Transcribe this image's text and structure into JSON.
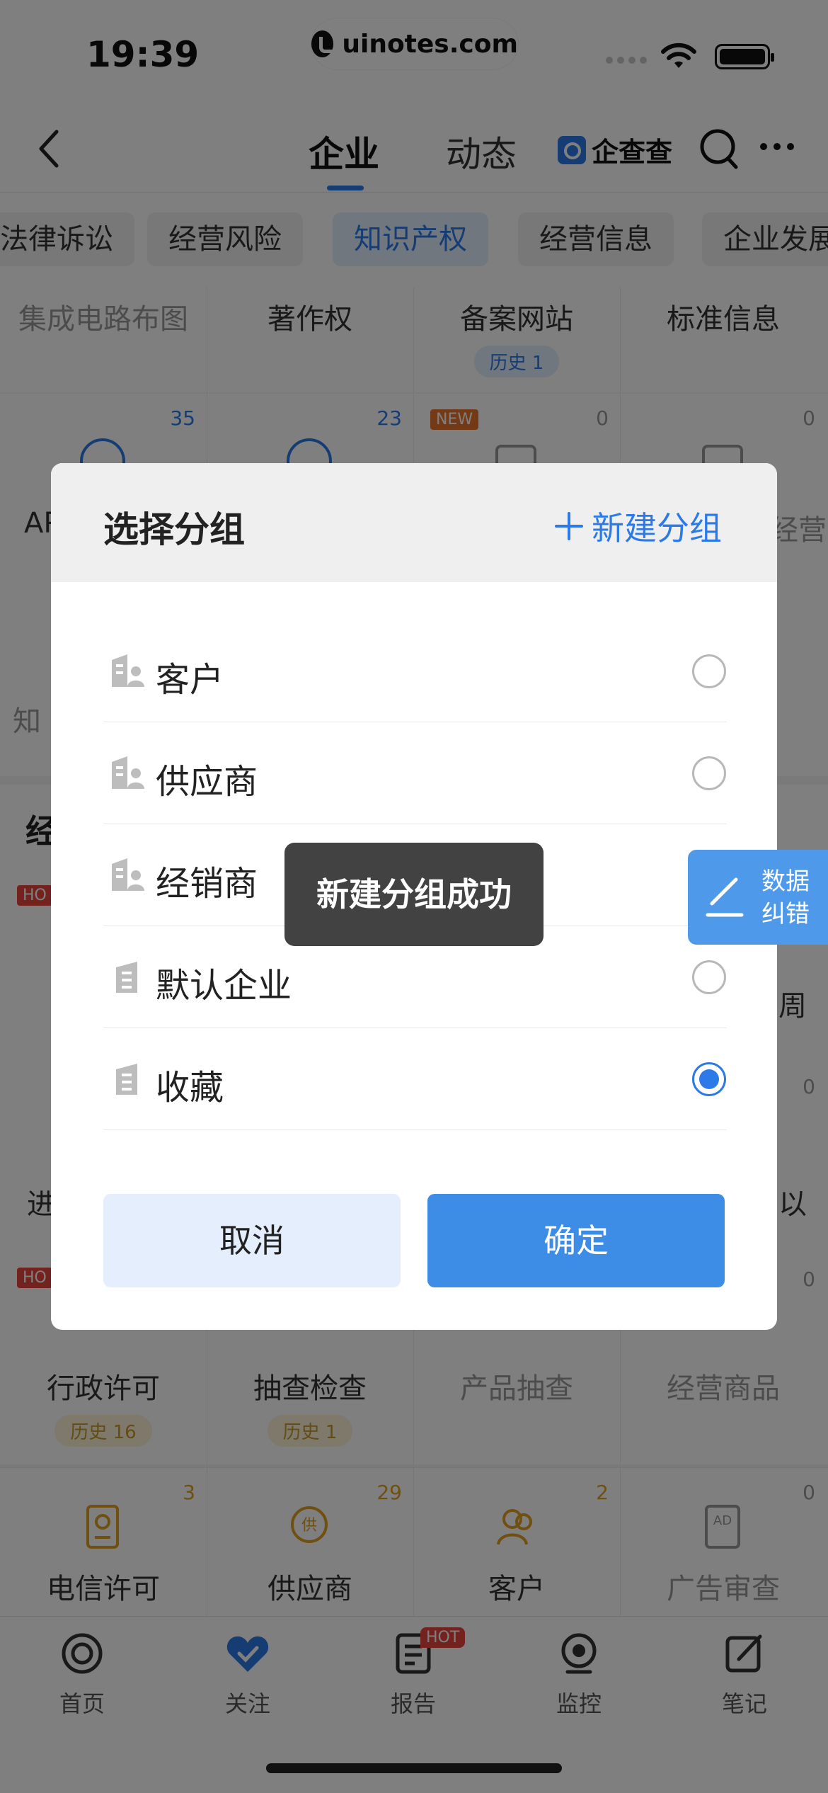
{
  "status_bar": {
    "time": "19:39",
    "watermark": "uinotes.com"
  },
  "nav": {
    "tab_company": "企业",
    "tab_news": "动态",
    "brand_name": "企查查"
  },
  "chips": [
    "法律诉讼",
    "经营风险",
    "知识产权",
    "经营信息",
    "企业发展"
  ],
  "ip_row": {
    "labels": [
      "集成电路布图",
      "著作权",
      "备案网站",
      "标准信息"
    ],
    "history": "历史 1"
  },
  "ip_row2": {
    "counts": [
      "35",
      "23",
      "0",
      "0"
    ],
    "new_tag": "NEW",
    "partial_left": "AP",
    "partial_right": "经营"
  },
  "partial_texts": {
    "zhi": "知",
    "jing": "经",
    "jin": "进",
    "hot": "HO",
    "hot2": "HO",
    "right1": "周",
    "right2": "以"
  },
  "license_row": {
    "labels": [
      "行政许可",
      "抽查检查",
      "产品抽查",
      "经营商品"
    ],
    "history_a": "历史 16",
    "history_b": "历史 1",
    "count_right": "0",
    "count_right_top": "0"
  },
  "bottom_row": {
    "labels": [
      "电信许可",
      "供应商",
      "客户",
      "广告审查"
    ],
    "counts": [
      "3",
      "29",
      "2",
      "0"
    ]
  },
  "tabbar": {
    "items": [
      "首页",
      "关注",
      "报告",
      "监控",
      "笔记"
    ],
    "hot_badge": "HOT"
  },
  "modal": {
    "title": "选择分组",
    "new_group": "新建分组",
    "groups": [
      {
        "label": "客户",
        "checked": false,
        "icon": "building-person-icon"
      },
      {
        "label": "供应商",
        "checked": false,
        "icon": "building-person-icon"
      },
      {
        "label": "经销商",
        "checked": false,
        "icon": "building-person-icon"
      },
      {
        "label": "默认企业",
        "checked": false,
        "icon": "building-icon"
      },
      {
        "label": "收藏",
        "checked": true,
        "icon": "building-icon"
      }
    ],
    "cancel": "取消",
    "confirm": "确定"
  },
  "toast": "新建分组成功",
  "feedback": {
    "line1": "数据",
    "line2": "纠错"
  },
  "colors": {
    "accent": "#2b7ae8",
    "confirm_bg": "#3d8ce6",
    "cancel_bg": "#e5eefc",
    "toast_bg": "#383838"
  }
}
